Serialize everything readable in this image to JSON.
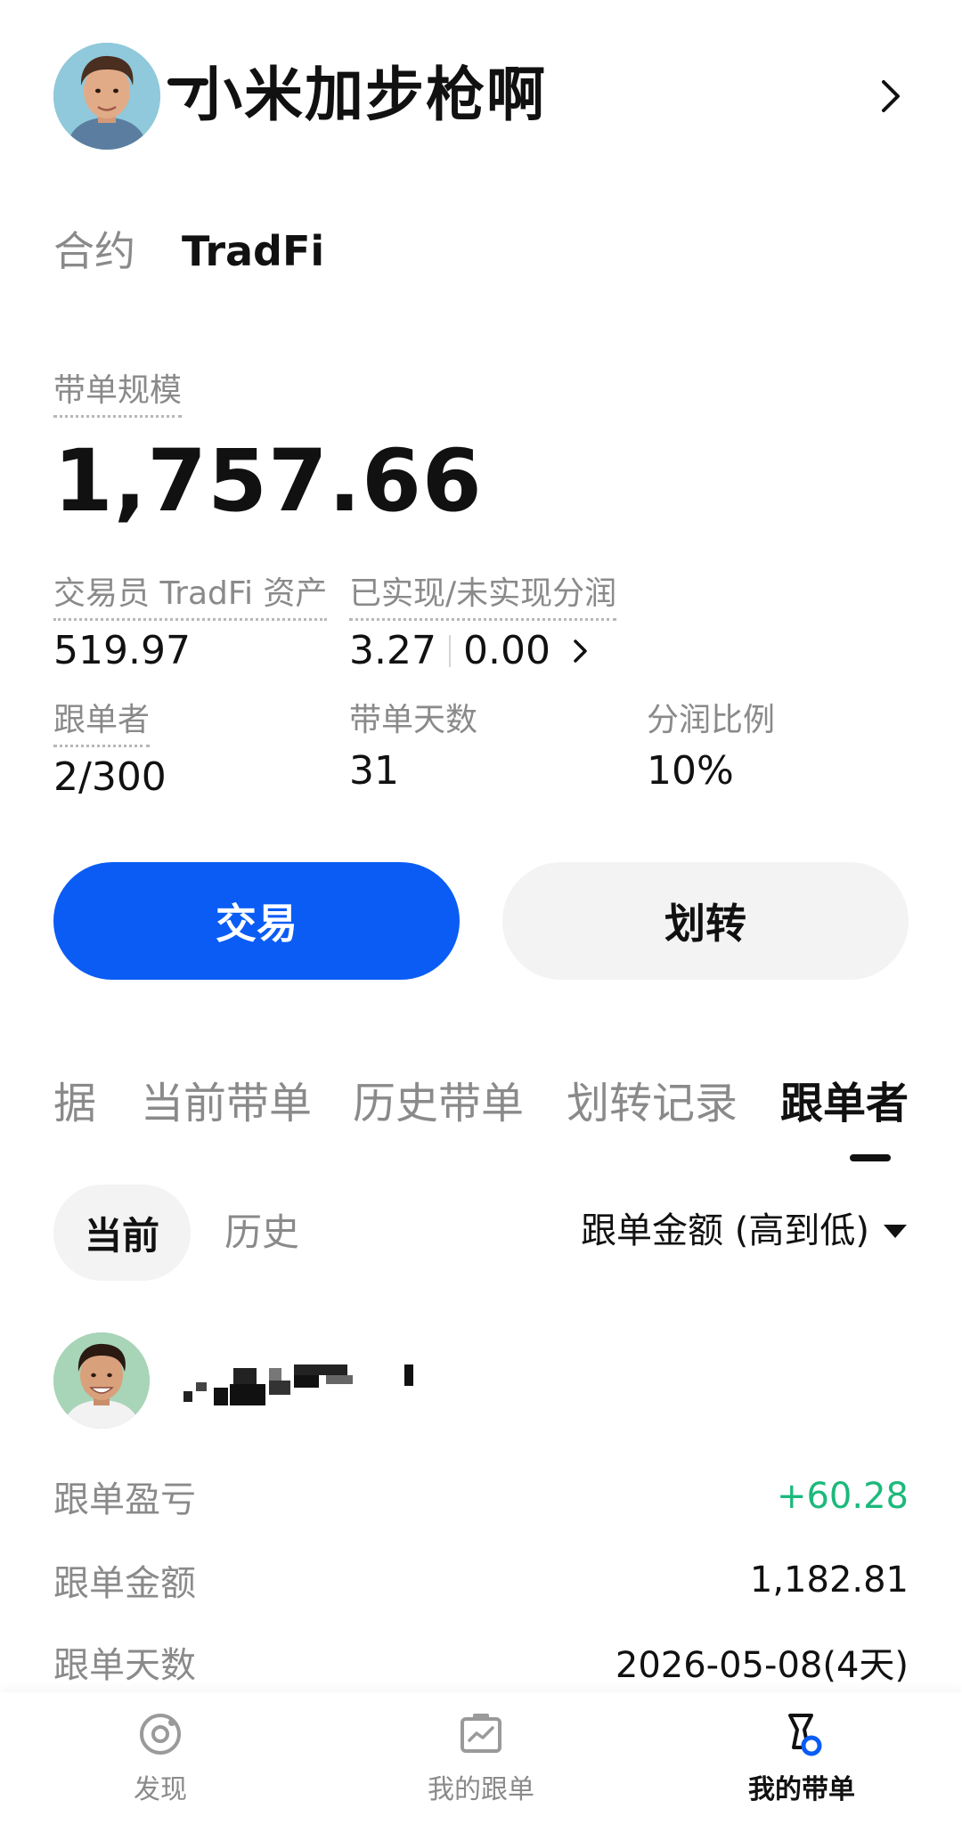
{
  "header": {
    "username": "小米加步枪啊",
    "avatar_icon": "person-avatar",
    "chevron_icon": "chevron-right-icon"
  },
  "top_tabs": [
    {
      "label": "合约",
      "active": false
    },
    {
      "label": "TradFi",
      "active": true
    }
  ],
  "summary": {
    "aum_label": "带单规模",
    "aum_value": "1,757.66",
    "trader_assets_label": "交易员 TradFi 资产",
    "trader_assets_value": "519.97",
    "profit_share_label": "已实现/未实现分润",
    "realized_value": "3.27",
    "unrealized_value": "0.00",
    "followers_label": "跟单者",
    "followers_value": "2/300",
    "days_label": "带单天数",
    "days_value": "31",
    "ratio_label": "分润比例",
    "ratio_value": "10%"
  },
  "actions": {
    "trade_label": "交易",
    "transfer_label": "划转",
    "trade_color": "#0a5cf5"
  },
  "sub_tabs": [
    {
      "label": "据",
      "active": false
    },
    {
      "label": "当前带单",
      "active": false
    },
    {
      "label": "历史带单",
      "active": false
    },
    {
      "label": "划转记录",
      "active": false
    },
    {
      "label": "跟单者",
      "active": true
    }
  ],
  "filter": {
    "current_label": "当前",
    "history_label": "历史",
    "sort_label": "跟单金额 (高到低)"
  },
  "follower": {
    "avatar_icon": "person-avatar",
    "name_masked": true,
    "pnl_label": "跟单盈亏",
    "pnl_value": "+60.28",
    "pnl_color": "#1cb97b",
    "amount_label": "跟单金额",
    "amount_value": "1,182.81",
    "days_label": "跟单天数",
    "days_value": "2026-05-08(4天)"
  },
  "bottom_nav": [
    {
      "label": "发现",
      "icon": "discover-icon",
      "active": false
    },
    {
      "label": "我的跟单",
      "icon": "chart-board-icon",
      "active": false
    },
    {
      "label": "我的带单",
      "icon": "lead-trader-icon",
      "active": true
    }
  ]
}
